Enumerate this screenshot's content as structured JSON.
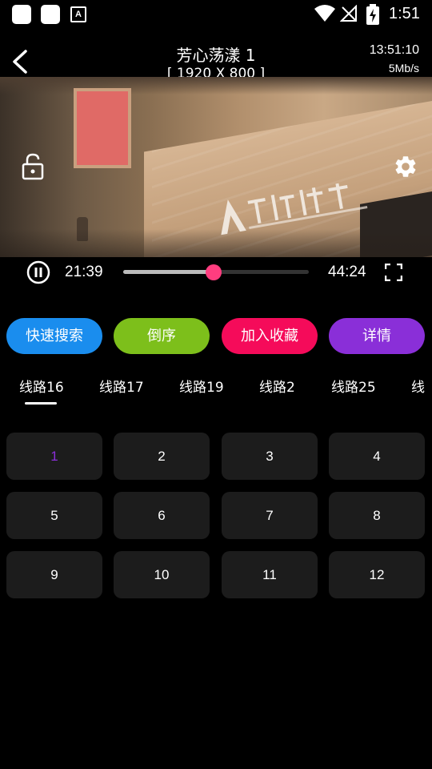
{
  "status_bar": {
    "time": "1:51",
    "notification_icons": [
      "app-icon",
      "app-icon",
      "font-a-icon"
    ],
    "status_icons": [
      "wifi-icon",
      "no-signal-icon",
      "battery-charging-icon"
    ]
  },
  "video": {
    "title": "芳心荡漾 1",
    "resolution": "[ 1920 X 800 ]",
    "clock": "13:51:10",
    "speed": "5Mb/s",
    "current_time": "21:39",
    "total_time": "44:24",
    "progress": 0.487
  },
  "actions": {
    "search": "快速搜索",
    "reverse": "倒序",
    "favorite": "加入收藏",
    "detail": "详情"
  },
  "colors": {
    "search": "#1a8dee",
    "reverse": "#7dbf1b",
    "favorite": "#f50b5a",
    "detail": "#8a2fd8",
    "progress_thumb": "#ff3d7f",
    "active_episode": "#8a2fd8"
  },
  "tabs": [
    "线路16",
    "线路17",
    "线路19",
    "线路2",
    "线路25",
    "线"
  ],
  "active_tab": 0,
  "episodes": [
    "1",
    "2",
    "3",
    "4",
    "5",
    "6",
    "7",
    "8",
    "9",
    "10",
    "11",
    "12"
  ],
  "active_episode": 0
}
